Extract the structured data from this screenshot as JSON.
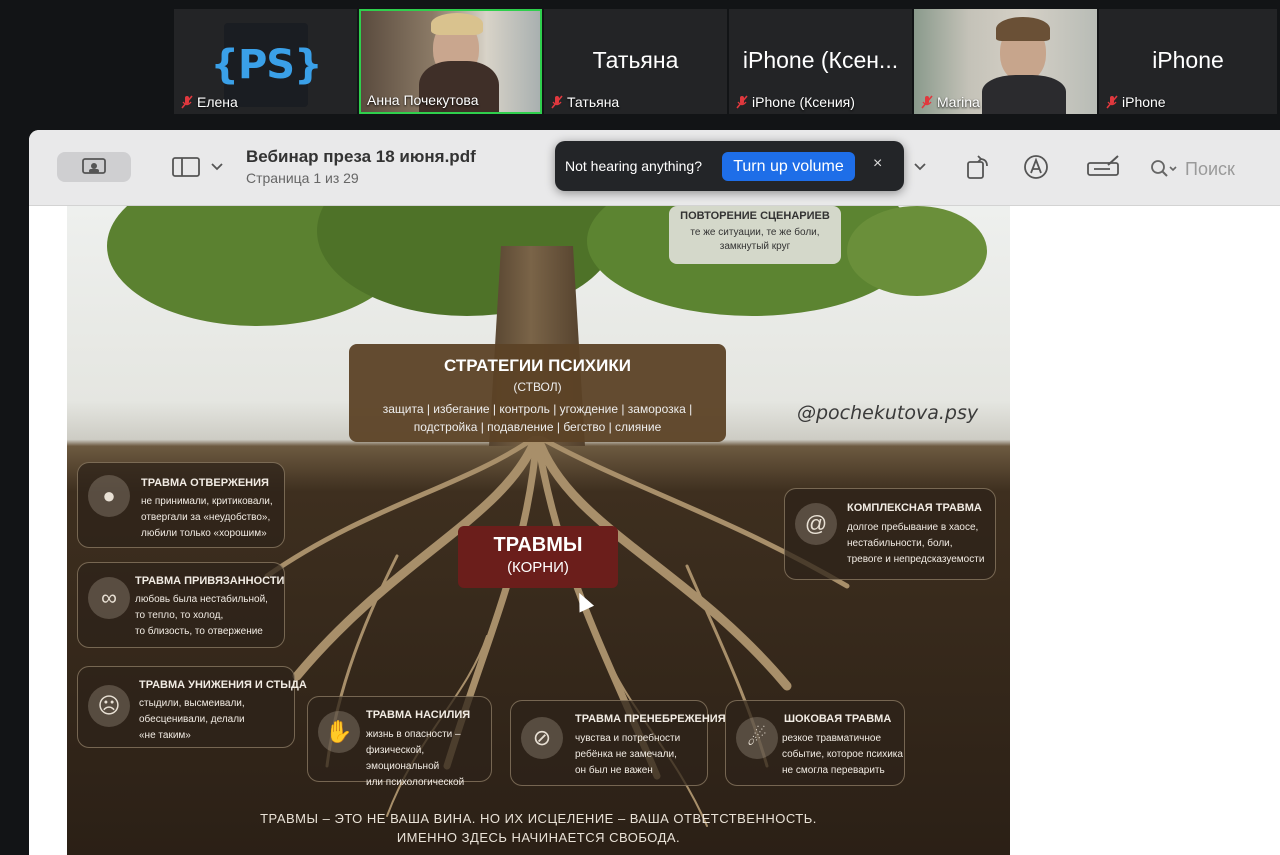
{
  "participants": [
    {
      "name": "Елена",
      "display": "PS",
      "display_brace_left": "{",
      "display_brace_right": "}"
    },
    {
      "name": "Анна Почекутова",
      "active": true
    },
    {
      "name": "Татьяна",
      "big_name": "Татьяна"
    },
    {
      "name": "iPhone (Ксения)",
      "big_name": "iPhone (Ксен..."
    },
    {
      "name": "Marina"
    },
    {
      "name": "iPhone",
      "big_name": "iPhone"
    }
  ],
  "window": {
    "title": "Вебинар преза 18 июня.pdf",
    "subtitle": "Страница 1 из 29",
    "search_placeholder": "Поиск"
  },
  "notice": {
    "text": "Not hearing anything?",
    "button": "Turn up volume",
    "close": "×"
  },
  "slide": {
    "repeat_title": "ПОВТОРЕНИЕ СЦЕНАРИЕВ",
    "repeat_line1": "те же ситуации, те же боли,",
    "repeat_line2": "замкнутый круг",
    "strategy_title": "СТРАТЕГИИ ПСИХИКИ",
    "strategy_sub": "(СТВОЛ)",
    "strategy_line1": "защита | избегание | контроль | угождение | заморозка |",
    "strategy_line2": "подстройка | подавление | бегство | слияние",
    "handle": "@pochekutova.psy",
    "trauma_title": "ТРАВМЫ",
    "trauma_sub": "(КОРНИ)",
    "cards": [
      {
        "title": "ТРАВМА ОТВЕРЖЕНИЯ",
        "lines": [
          "не принимали, критиковали,",
          "отвергали за «неудобство»,",
          "любили только «хорошим»"
        ]
      },
      {
        "title": "ТРАВМА ПРИВЯЗАННОСТИ",
        "lines": [
          "любовь была нестабильной,",
          "то тепло, то холод,",
          "то близость, то отвержение"
        ]
      },
      {
        "title": "ТРАВМА УНИЖЕНИЯ И СТЫДА",
        "lines": [
          "стыдили, высмеивали,",
          "обесценивали, делали",
          "«не таким»"
        ]
      },
      {
        "title": "ТРАВМА НАСИЛИЯ",
        "lines": [
          "жизнь в опасности –",
          "физической, эмоциональной",
          "или психологической"
        ]
      },
      {
        "title": "ТРАВМА ПРЕНЕБРЕЖЕНИЯ",
        "lines": [
          "чувства и потребности",
          "ребёнка не замечали,",
          "он был не важен"
        ]
      },
      {
        "title": "ШОКОВАЯ ТРАВМА",
        "lines": [
          "резкое травматичное",
          "событие, которое психика",
          "не смогла переварить"
        ]
      },
      {
        "title": "КОМПЛЕКСНАЯ ТРАВМА",
        "lines": [
          "долгое пребывание в хаосе,",
          "нестабильности, боли,",
          "тревоге и непредсказуемости"
        ]
      }
    ],
    "footer_line1": "ТРАВМЫ – ЭТО НЕ ВАША ВИНА. НО ИХ ИСЦЕЛЕНИЕ – ВАША ОТВЕТСТВЕННОСТЬ.",
    "footer_line2": "ИМЕННО ЗДЕСЬ НАЧИНАЕТСЯ СВОБОДА."
  },
  "colors": {
    "active_speaker_border": "#2fcf4d",
    "mute_icon": "#e0383e",
    "volume_button": "#1e6ee8",
    "trauma_box": "#6b1e1b"
  }
}
